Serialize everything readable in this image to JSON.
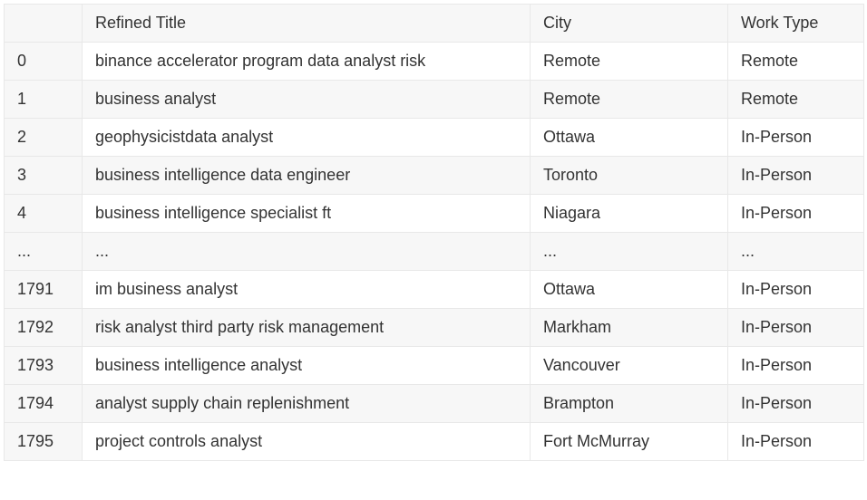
{
  "table": {
    "headers": {
      "index": "",
      "title": "Refined Title",
      "city": "City",
      "work_type": "Work Type"
    },
    "rows": [
      {
        "index": "0",
        "title": "binance accelerator program data analyst risk",
        "city": "Remote",
        "work_type": "Remote"
      },
      {
        "index": "1",
        "title": "business analyst",
        "city": "Remote",
        "work_type": "Remote"
      },
      {
        "index": "2",
        "title": "geophysicistdata analyst",
        "city": "Ottawa",
        "work_type": "In-Person"
      },
      {
        "index": "3",
        "title": "business intelligence data engineer",
        "city": "Toronto",
        "work_type": "In-Person"
      },
      {
        "index": "4",
        "title": "business intelligence specialist ft",
        "city": "Niagara",
        "work_type": "In-Person"
      },
      {
        "index": "...",
        "title": "...",
        "city": "...",
        "work_type": "..."
      },
      {
        "index": "1791",
        "title": "im business analyst",
        "city": "Ottawa",
        "work_type": "In-Person"
      },
      {
        "index": "1792",
        "title": "risk analyst third party risk management",
        "city": "Markham",
        "work_type": "In-Person"
      },
      {
        "index": "1793",
        "title": "business intelligence analyst",
        "city": "Vancouver",
        "work_type": "In-Person"
      },
      {
        "index": "1794",
        "title": "analyst supply chain replenishment",
        "city": "Brampton",
        "work_type": "In-Person"
      },
      {
        "index": "1795",
        "title": "project controls analyst",
        "city": "Fort McMurray",
        "work_type": "In-Person"
      }
    ]
  }
}
